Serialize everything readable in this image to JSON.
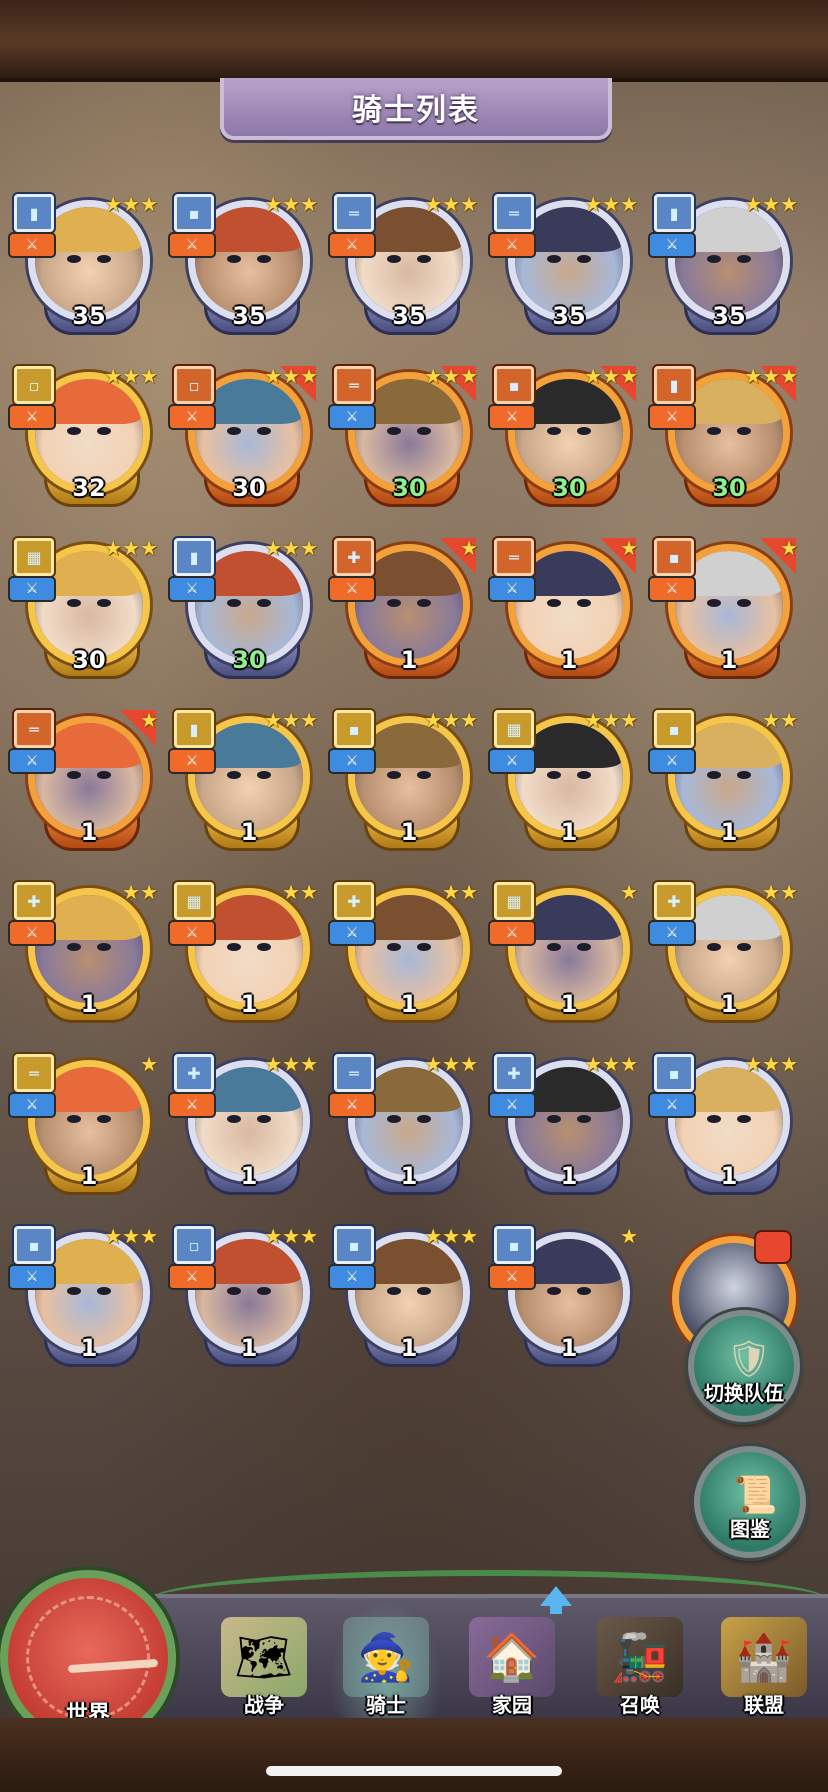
{
  "header": {
    "title": "骑士列表"
  },
  "knights": [
    {
      "level": "35",
      "stars": "★★★",
      "frame": "blue",
      "badge": "▮",
      "role": "orange",
      "level_color": "white",
      "promo": false
    },
    {
      "level": "35",
      "stars": "★★★",
      "frame": "blue",
      "badge": "▪",
      "role": "orange",
      "level_color": "white",
      "promo": false
    },
    {
      "level": "35",
      "stars": "★★★",
      "frame": "blue",
      "badge": "═",
      "role": "orange",
      "level_color": "white",
      "promo": false
    },
    {
      "level": "35",
      "stars": "★★★",
      "frame": "blue",
      "badge": "═",
      "role": "orange",
      "level_color": "white",
      "promo": false
    },
    {
      "level": "35",
      "stars": "★★★",
      "frame": "blue",
      "badge": "▮",
      "role": "blue",
      "level_color": "white",
      "promo": false
    },
    {
      "level": "32",
      "stars": "★★★",
      "frame": "gold",
      "badge": "▫",
      "role": "orange",
      "level_color": "white",
      "promo": false
    },
    {
      "level": "30",
      "stars": "★★★",
      "frame": "orange",
      "badge": "▫",
      "role": "orange",
      "level_color": "white",
      "promo": true
    },
    {
      "level": "30",
      "stars": "★★★",
      "frame": "orange",
      "badge": "═",
      "role": "blue",
      "level_color": "green",
      "promo": true
    },
    {
      "level": "30",
      "stars": "★★★",
      "frame": "orange",
      "badge": "▪",
      "role": "orange",
      "level_color": "green",
      "promo": true
    },
    {
      "level": "30",
      "stars": "★★★",
      "frame": "orange",
      "badge": "▮",
      "role": "orange",
      "level_color": "green",
      "promo": true
    },
    {
      "level": "30",
      "stars": "★★★",
      "frame": "gold",
      "badge": "▦",
      "role": "blue",
      "level_color": "white",
      "promo": false
    },
    {
      "level": "30",
      "stars": "★★★",
      "frame": "blue",
      "badge": "▮",
      "role": "blue",
      "level_color": "green",
      "promo": false
    },
    {
      "level": "1",
      "stars": "★",
      "frame": "orange",
      "badge": "✚",
      "role": "orange",
      "level_color": "white",
      "promo": true
    },
    {
      "level": "1",
      "stars": "★",
      "frame": "orange",
      "badge": "═",
      "role": "blue",
      "level_color": "white",
      "promo": true
    },
    {
      "level": "1",
      "stars": "★",
      "frame": "orange",
      "badge": "▪",
      "role": "orange",
      "level_color": "white",
      "promo": true
    },
    {
      "level": "1",
      "stars": "★",
      "frame": "orange",
      "badge": "═",
      "role": "blue",
      "level_color": "white",
      "promo": true
    },
    {
      "level": "1",
      "stars": "★★★",
      "frame": "gold",
      "badge": "▮",
      "role": "orange",
      "level_color": "white",
      "promo": false
    },
    {
      "level": "1",
      "stars": "★★★",
      "frame": "gold",
      "badge": "▪",
      "role": "blue",
      "level_color": "white",
      "promo": false
    },
    {
      "level": "1",
      "stars": "★★★",
      "frame": "gold",
      "badge": "▦",
      "role": "blue",
      "level_color": "white",
      "promo": false
    },
    {
      "level": "1",
      "stars": "★★",
      "frame": "gold",
      "badge": "▪",
      "role": "blue",
      "level_color": "white",
      "promo": false
    },
    {
      "level": "1",
      "stars": "★★",
      "frame": "gold",
      "badge": "✚",
      "role": "orange",
      "level_color": "white",
      "promo": false
    },
    {
      "level": "1",
      "stars": "★★",
      "frame": "gold",
      "badge": "▦",
      "role": "orange",
      "level_color": "white",
      "promo": false
    },
    {
      "level": "1",
      "stars": "★★",
      "frame": "gold",
      "badge": "✚",
      "role": "blue",
      "level_color": "white",
      "promo": false
    },
    {
      "level": "1",
      "stars": "★",
      "frame": "gold",
      "badge": "▦",
      "role": "orange",
      "level_color": "white",
      "promo": false
    },
    {
      "level": "1",
      "stars": "★★",
      "frame": "gold",
      "badge": "✚",
      "role": "blue",
      "level_color": "white",
      "promo": false
    },
    {
      "level": "1",
      "stars": "★",
      "frame": "gold",
      "badge": "═",
      "role": "blue",
      "level_color": "white",
      "promo": false
    },
    {
      "level": "1",
      "stars": "★★★",
      "frame": "blue",
      "badge": "✚",
      "role": "orange",
      "level_color": "white",
      "promo": false
    },
    {
      "level": "1",
      "stars": "★★★",
      "frame": "blue",
      "badge": "═",
      "role": "orange",
      "level_color": "white",
      "promo": false
    },
    {
      "level": "1",
      "stars": "★★★",
      "frame": "blue",
      "badge": "✚",
      "role": "blue",
      "level_color": "white",
      "promo": false
    },
    {
      "level": "1",
      "stars": "★★★",
      "frame": "blue",
      "badge": "▪",
      "role": "blue",
      "level_color": "white",
      "promo": false
    },
    {
      "level": "1",
      "stars": "★★★",
      "frame": "blue",
      "badge": "▪",
      "role": "blue",
      "level_color": "white",
      "promo": false
    },
    {
      "level": "1",
      "stars": "★★★",
      "frame": "blue",
      "badge": "▫",
      "role": "orange",
      "level_color": "white",
      "promo": false
    },
    {
      "level": "1",
      "stars": "★★★",
      "frame": "blue",
      "badge": "▪",
      "role": "blue",
      "level_color": "white",
      "promo": false
    },
    {
      "level": "1",
      "stars": "★",
      "frame": "blue",
      "badge": "▪",
      "role": "orange",
      "level_color": "white",
      "promo": false
    }
  ],
  "side_buttons": {
    "switch_team": "切换队伍",
    "codex": "图鉴"
  },
  "nav": {
    "world": "世界",
    "items": [
      {
        "label": "战争",
        "icon": "map-icon"
      },
      {
        "label": "骑士",
        "icon": "knight-icon"
      },
      {
        "label": "家园",
        "icon": "house-icon"
      },
      {
        "label": "召唤",
        "icon": "train-icon"
      },
      {
        "label": "联盟",
        "icon": "alliance-icon"
      }
    ],
    "active": "骑士"
  },
  "colors": {
    "blue_frame": "#dcdff0",
    "gold_frame": "#f5c64a",
    "orange_frame": "#f2a13b",
    "level_green": "#8df28d",
    "badge_blue": "#5b86c6"
  }
}
